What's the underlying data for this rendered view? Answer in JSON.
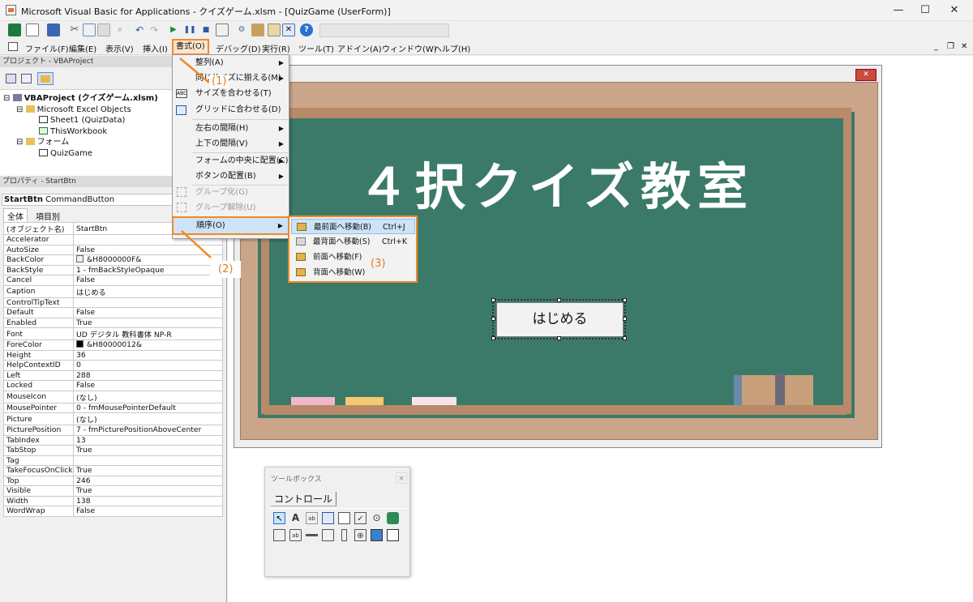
{
  "window": {
    "title": "Microsoft Visual Basic for Applications - クイズゲーム.xlsm - [QuizGame (UserForm)]",
    "minimize": "—",
    "maximize": "☐",
    "close": "✕"
  },
  "menubar": {
    "items": [
      "ファイル(F)",
      "編集(E)",
      "表示(V)",
      "挿入(I)",
      "書式(O)",
      "デバッグ(D)",
      "実行(R)",
      "ツール(T)",
      "アドイン(A)",
      "ウィンドウ(W)",
      "ヘルプ(H)"
    ],
    "active": "書式(O)"
  },
  "project_panel": {
    "title": "プロジェクト - VBAProject",
    "tree": [
      {
        "label": "VBAProject (クイズゲーム.xlsm)",
        "level": 0,
        "icon": "vba-project-icon"
      },
      {
        "label": "Microsoft Excel Objects",
        "level": 1,
        "icon": "folder-icon"
      },
      {
        "label": "Sheet1 (QuizData)",
        "level": 2,
        "icon": "sheet-icon"
      },
      {
        "label": "ThisWorkbook",
        "level": 2,
        "icon": "workbook-icon"
      },
      {
        "label": "フォーム",
        "level": 1,
        "icon": "folder-icon"
      },
      {
        "label": "QuizGame",
        "level": 2,
        "icon": "form-icon"
      }
    ]
  },
  "properties_panel": {
    "title": "プロパティ - StartBtn",
    "object_name": "StartBtn",
    "object_type": "CommandButton",
    "tabs": [
      "全体",
      "項目別"
    ],
    "rows": [
      [
        "(オブジェクト名)",
        "StartBtn"
      ],
      [
        "Accelerator",
        ""
      ],
      [
        "AutoSize",
        "False"
      ],
      [
        "BackColor",
        "&H8000000F&"
      ],
      [
        "BackStyle",
        "1 - fmBackStyleOpaque"
      ],
      [
        "Cancel",
        "False"
      ],
      [
        "Caption",
        "はじめる"
      ],
      [
        "ControlTipText",
        ""
      ],
      [
        "Default",
        "False"
      ],
      [
        "Enabled",
        "True"
      ],
      [
        "Font",
        "UD デジタル 教科書体 NP-R"
      ],
      [
        "ForeColor",
        "&H80000012&"
      ],
      [
        "Height",
        "36"
      ],
      [
        "HelpContextID",
        "0"
      ],
      [
        "Left",
        "288"
      ],
      [
        "Locked",
        "False"
      ],
      [
        "MouseIcon",
        "(なし)"
      ],
      [
        "MousePointer",
        "0 - fmMousePointerDefault"
      ],
      [
        "Picture",
        "(なし)"
      ],
      [
        "PicturePosition",
        "7 - fmPicturePositionAboveCenter"
      ],
      [
        "TabIndex",
        "13"
      ],
      [
        "TabStop",
        "True"
      ],
      [
        "Tag",
        ""
      ],
      [
        "TakeFocusOnClick",
        "True"
      ],
      [
        "Top",
        "246"
      ],
      [
        "Visible",
        "True"
      ],
      [
        "Width",
        "138"
      ],
      [
        "WordWrap",
        "False"
      ]
    ],
    "colors": {
      "BackColor": "#f0f0f0",
      "ForeColor": "#000000"
    }
  },
  "format_menu": {
    "items": [
      {
        "label": "整列(A)",
        "submenu": true
      },
      {
        "label": "同じサイズに揃える(M)",
        "submenu": true
      },
      {
        "label": "サイズを合わせる(T)",
        "submenu": false
      },
      {
        "label": "グリッドに合わせる(D)",
        "submenu": false
      },
      {
        "label": "左右の間隔(H)",
        "submenu": true
      },
      {
        "label": "上下の間隔(V)",
        "submenu": true
      },
      {
        "label": "フォームの中央に配置(C)",
        "submenu": true
      },
      {
        "label": "ボタンの配置(B)",
        "submenu": true
      },
      {
        "label": "グループ化(G)",
        "disabled": true
      },
      {
        "label": "グループ解除(U)",
        "disabled": true
      },
      {
        "label": "順序(O)",
        "submenu": true,
        "highlighted": true
      }
    ]
  },
  "order_submenu": {
    "items": [
      {
        "label": "最前面へ移動(B)",
        "shortcut": "Ctrl+J"
      },
      {
        "label": "最背面へ移動(S)",
        "shortcut": "Ctrl+K"
      },
      {
        "label": "前面へ移動(F)",
        "shortcut": ""
      },
      {
        "label": "背面へ移動(W)",
        "shortcut": ""
      }
    ]
  },
  "callouts": {
    "one": "(1)",
    "two": "(2)",
    "three": "(3)"
  },
  "userform": {
    "close": "✕",
    "board_title": "４択クイズ教室",
    "start_button": "はじめる"
  },
  "toolbox": {
    "title": "ツールボックス",
    "close": "×",
    "tab": "コントロール",
    "tools": [
      "select-pointer-icon",
      "label-icon",
      "textbox-icon",
      "combobox-icon",
      "listbox-icon",
      "checkbox-icon",
      "optionbutton-icon",
      "togglebutton-icon",
      "frame-icon",
      "commandbutton-icon",
      "tabstrip-icon",
      "multipage-icon",
      "scrollbar-icon",
      "spinbutton-icon",
      "image-icon",
      "refedit-icon"
    ]
  },
  "accent_color": "#f08a24"
}
